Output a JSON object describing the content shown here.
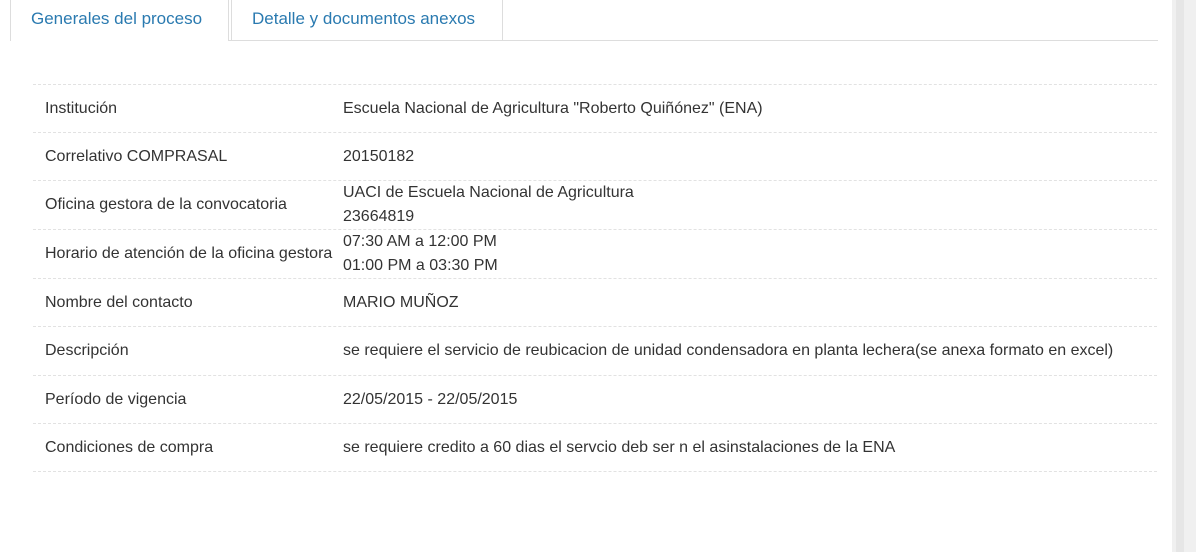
{
  "tabs": [
    {
      "label": "Generales del proceso"
    },
    {
      "label": "Detalle y documentos anexos"
    }
  ],
  "details": [
    {
      "label": "Institución",
      "value": [
        "Escuela Nacional de Agricultura \"Roberto Quiñónez\" (ENA)"
      ]
    },
    {
      "label": "Correlativo COMPRASAL",
      "value": [
        "20150182"
      ]
    },
    {
      "label": "Oficina gestora de la convocatoria",
      "value": [
        "UACI de Escuela Nacional de Agricultura",
        "23664819"
      ]
    },
    {
      "label": "Horario de atención de la oficina gestora",
      "value": [
        "07:30 AM a 12:00 PM",
        "01:00 PM a 03:30 PM"
      ]
    },
    {
      "label": "Nombre del contacto",
      "value": [
        "MARIO MUÑOZ"
      ]
    },
    {
      "label": "Descripción",
      "value": [
        "se requiere el servicio de reubicacion de unidad condensadora en planta lechera(se anexa formato en excel)"
      ]
    },
    {
      "label": "Período de vigencia",
      "value": [
        "22/05/2015 - 22/05/2015"
      ]
    },
    {
      "label": "Condiciones de compra",
      "value": [
        "se requiere credito a 60 dias el servcio deb ser n el asinstalaciones de la ENA"
      ]
    }
  ]
}
